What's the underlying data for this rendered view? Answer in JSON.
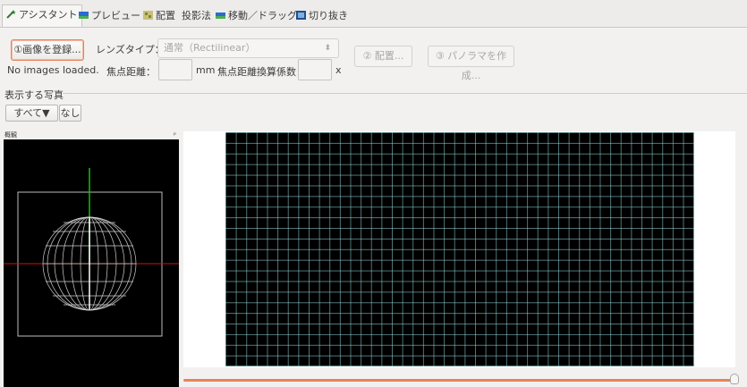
{
  "tabs": [
    {
      "label": "アシスタント",
      "icon": "wand-icon",
      "color": "#2e7d32",
      "active": true
    },
    {
      "label": "プレビュー",
      "icon": "preview-icon",
      "color": "#2a6bd0"
    },
    {
      "label": "配置",
      "icon": "layout-icon",
      "color": "#7a8a3a"
    },
    {
      "label": "投影法",
      "icon": "",
      "color": ""
    },
    {
      "label": "移動／ドラッグ",
      "icon": "move-icon",
      "color": "#2a6bd0"
    },
    {
      "label": "切り抜き",
      "icon": "crop-icon",
      "color": "#1d4f8f"
    }
  ],
  "assistant": {
    "load_images_label": "①画像を登録...",
    "status": "No images loaded.",
    "lens_type_label": "レンズタイプ：",
    "lens_type_value": "通常（Rectilinear）",
    "focal_length_label": "焦点距離：",
    "focal_length_value": "",
    "focal_unit": "mm",
    "crop_factor_label": "焦点距離換算係数：",
    "crop_factor_value": "",
    "crop_unit": "x",
    "align_label": "② 配置...",
    "create_panorama_label": "③ パノラマを作成..."
  },
  "display_images": {
    "heading": "表示する写真",
    "all_label": "すべて▼",
    "none_label": "なし"
  },
  "overview": {
    "title": "概観",
    "pin": "ᵖ"
  },
  "colors": {
    "accent": "#e8825a",
    "grid_line": "#96d7d7",
    "axis_red": "#d01010",
    "axis_green": "#10c010"
  }
}
